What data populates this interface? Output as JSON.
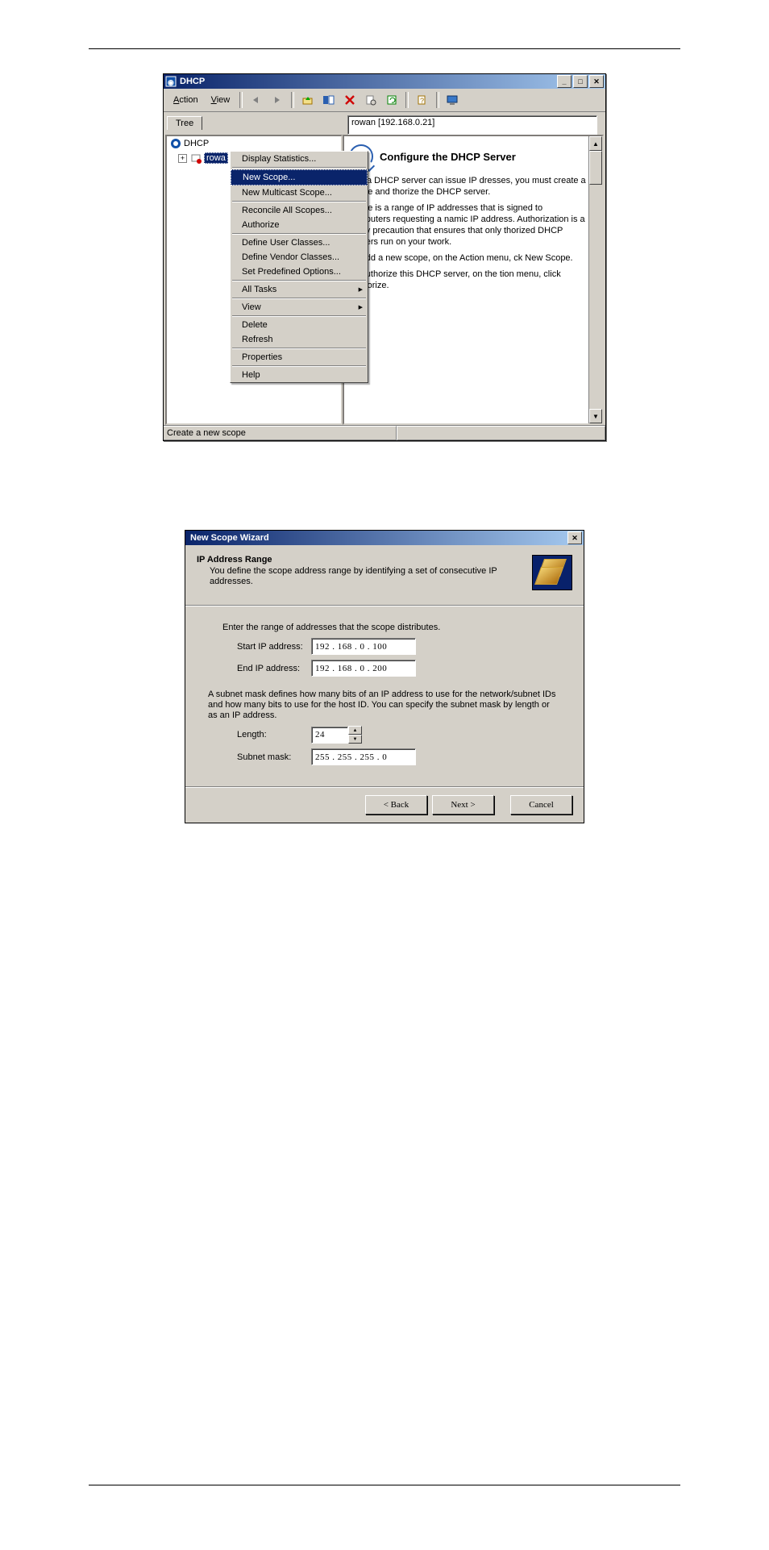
{
  "win1": {
    "title": "DHCP",
    "menu": {
      "action": "Action",
      "view": "View"
    },
    "tab_label": "Tree",
    "crumb": "rowan [192.168.0.21]",
    "tree_root": "DHCP",
    "tree_server_prefix": "rowa",
    "context_menu": {
      "display_stats": "Display Statistics...",
      "new_scope": "New Scope...",
      "new_multicast": "New Multicast Scope...",
      "reconcile": "Reconcile All Scopes...",
      "authorize": "Authorize",
      "user_classes": "Define User Classes...",
      "vendor_classes": "Define Vendor Classes...",
      "predefined": "Set Predefined Options...",
      "all_tasks": "All Tasks",
      "view": "View",
      "delete": "Delete",
      "refresh": "Refresh",
      "properties": "Properties",
      "help": "Help"
    },
    "content": {
      "heading": "Configure the DHCP Server",
      "p1_visible": "fore a DHCP server can issue IP dresses, you must create a scope and thorize the DHCP server.",
      "p2_visible": "scope is a range of IP addresses that is signed to computers requesting a namic IP address. Authorization is a curity precaution that ensures that only thorized DHCP servers run on your twork.",
      "p3": "To add a new scope, on the Action menu, ck New Scope.",
      "p4": "To authorize this DHCP server, on the tion menu, click Authorize."
    },
    "status": "Create a new scope"
  },
  "wiz": {
    "title": "New Scope Wizard",
    "header_title": "IP Address Range",
    "header_desc": "You define the scope address range by identifying a set of consecutive IP addresses.",
    "body_intro": "Enter the range of addresses that the scope distributes.",
    "start_label": "Start IP address:",
    "start_value": "192 . 168 .   0  . 100",
    "end_label": "End IP address:",
    "end_value": "192 . 168 .   0  . 200",
    "subnet_text": "A subnet mask defines how many bits of an IP address to use for the network/subnet IDs and how many bits to use for the host ID. You can specify the subnet mask by length or as an IP address.",
    "length_label": "Length:",
    "length_value": "24",
    "mask_label": "Subnet mask:",
    "mask_value": "255 . 255 . 255 .   0",
    "back": "< Back",
    "next": "Next >",
    "cancel": "Cancel"
  }
}
